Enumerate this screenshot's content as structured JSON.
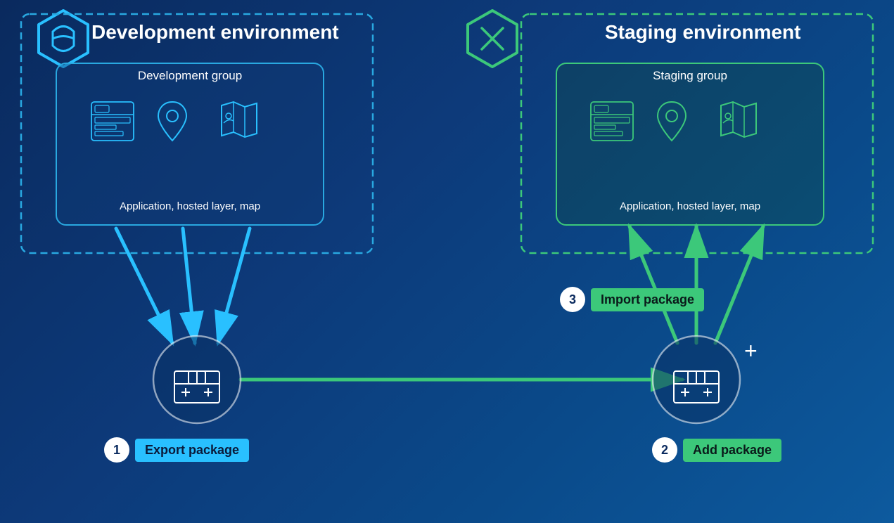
{
  "dev_env": {
    "title": "Development environment",
    "group_label": "Development group",
    "app_label": "Application, hosted layer, map"
  },
  "staging_env": {
    "title": "Staging environment",
    "group_label": "Staging group",
    "app_label": "Application, hosted layer, map"
  },
  "steps": {
    "step1_number": "1",
    "step1_label": "Export package",
    "step2_number": "2",
    "step2_label": "Add package",
    "step3_number": "3",
    "step3_label": "Import package"
  },
  "colors": {
    "dev_border": "#29a8e0",
    "staging_border": "#3cc87a",
    "background_start": "#0a2a5e",
    "background_end": "#0d5a9e",
    "export_badge_bg": "#29c0ff",
    "import_badge_bg": "#3cc87a",
    "add_badge_bg": "#3cc87a"
  }
}
